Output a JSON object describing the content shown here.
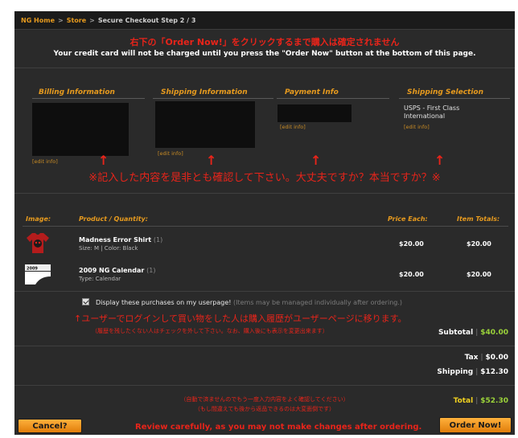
{
  "breadcrumb": {
    "home": "NG Home",
    "store": "Store",
    "current": "Secure Checkout Step 2 / 3",
    "separator": ">"
  },
  "notices": {
    "jp_top": "右下の「Order Now!」をクリックするまで購入は確定されません",
    "en_top": "Your credit card will not be charged until you press the \"Order Now\" button at the bottom of this page.",
    "jp_confirm": "※記入した内容を是非とも確認して下さい。大丈夫ですか？本当ですか？※",
    "arrow": "↑",
    "jp_usepage": "↑ユーザーでログインして買い物をした人は購入履歴がユーザーページに移ります。",
    "jp_usepage_sub": "（履歴を残したくない人はチェックを外して下さい。なお、購入後にも表示を変更出来ます）",
    "jp_bottom_1": "（自動で済ませんのでもう一度入力内容をよく確認してください）",
    "jp_bottom_2": "（もし間違えても後から返品できるのは大変面倒です）",
    "review": "Review carefully, as you may not make changes after ordering."
  },
  "info": {
    "billing_title": "Billing Information",
    "shipping_title": "Shipping Information",
    "payment_title": "Payment Info",
    "selection_title": "Shipping Selection",
    "edit_label": "[edit info]",
    "shipping_selection": "USPS - First Class International"
  },
  "table": {
    "headers": [
      "Image:",
      "Product / Quantity:",
      "Price Each:",
      "Item Totals:"
    ],
    "items": [
      {
        "name": "Madness Error Shirt",
        "qty": "(1)",
        "meta": "Size: M | Color: Black",
        "price": "$20.00",
        "total": "$20.00"
      },
      {
        "name": "2009 NG Calendar",
        "qty": "(1)",
        "meta": "Type: Calendar",
        "price": "$20.00",
        "total": "$20.00"
      }
    ]
  },
  "userpage": {
    "label": "Display these purchases on my userpage!",
    "note": "(Items may be managed individually after ordering.)"
  },
  "totals": {
    "subtotal_label": "Subtotal",
    "subtotal": "$40.00",
    "tax_label": "Tax",
    "tax": "$0.00",
    "shipping_label": "Shipping",
    "shipping": "$12.30",
    "total_label": "Total",
    "total": "$52.30",
    "separator": "|"
  },
  "buttons": {
    "cancel": "Cancel?",
    "order": "Order Now!"
  },
  "colors": {
    "accent_orange": "#e69a1e",
    "jp_red": "#e8241a",
    "subtotal_green": "#9bd33a",
    "total_yellow": "#f0d020"
  }
}
